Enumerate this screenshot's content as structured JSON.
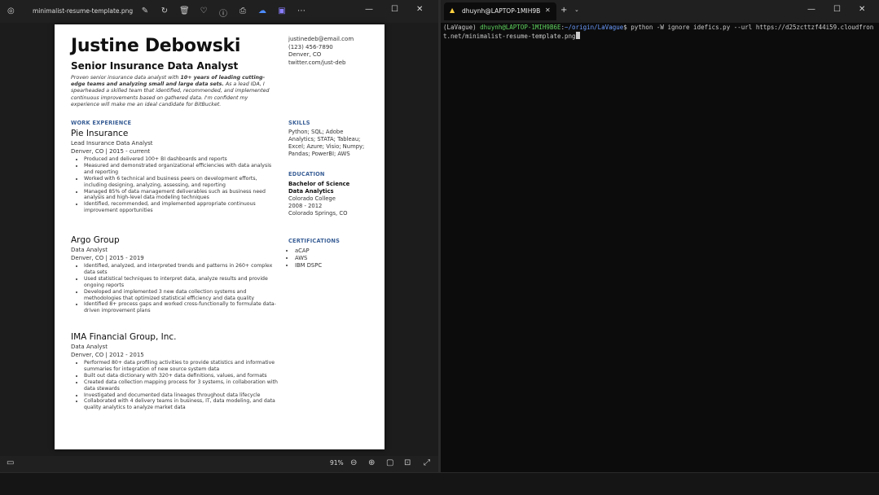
{
  "viewer": {
    "title": "minimalist-resume-template.png",
    "zoom": "91%",
    "icons": {
      "app": "photos-icon",
      "tools": [
        "edit-icon",
        "rotate-icon",
        "delete-icon",
        "favorite-icon",
        "info-icon",
        "print-icon",
        "cloud-icon",
        "share-icon",
        "more-icon"
      ]
    }
  },
  "resume": {
    "name": "Justine Debowski",
    "role": "Senior Insurance Data Analyst",
    "contact": [
      "justinedeb@email.com",
      "(123) 456-7890",
      "Denver, CO",
      "twitter.com/just-deb"
    ],
    "summary_a": "Proven senior insurance data analyst with ",
    "summary_b": "10+ years of leading cutting-edge teams and analyzing small and large data sets.",
    "summary_c": " As a lead IDA, I spearheaded a skilled team that identified, recommended, and implemented continuous improvements based on gathered data. I'm confident my experience will make me an ideal candidate for BitBucket.",
    "work_heading": "WORK EXPERIENCE",
    "jobs": [
      {
        "company": "Pie Insurance",
        "title": "Lead Insurance Data Analyst",
        "meta": "Denver, CO  |  2015 - current",
        "bullets": [
          "Produced and delivered 100+ BI dashboards and reports",
          "Measured and demonstrated organizational efficiencies with data analysis and reporting",
          "Worked with 6 technical and business peers on development efforts, including designing, analyzing, assessing, and reporting",
          "Managed 85% of data management deliverables such as business need analysis and high-level data modeling techniques",
          "Identified, recommended, and implemented appropriate continuous improvement opportunities"
        ]
      },
      {
        "company": "Argo Group",
        "title": "Data Analyst",
        "meta": "Denver, CO  |  2015 - 2019",
        "bullets": [
          "Identified, analyzed, and interpreted trends and patterns in 260+ complex data sets",
          "Used statistical techniques to interpret data, analyze results and provide ongoing reports",
          "Developed and implemented 3 new data collection systems and methodologies that optimized statistical efficiency and data quality",
          "Identified 8+ process gaps and worked cross-functionally to formulate data-driven improvement plans"
        ]
      },
      {
        "company": "IMA Financial Group, Inc.",
        "title": "Data Analyst",
        "meta": "Denver, CO  |  2012 - 2015",
        "bullets": [
          "Performed 80+ data profiling activities to provide statistics and informative summaries for integration of new source system data",
          "Built out data dictionary with 320+ data definitions, values, and formats",
          "Created data collection mapping process for 3 systems, in collaboration with data stewards",
          "Investigated and documented data lineages throughout data lifecycle",
          "Collaborated with 4 delivery teams in business, IT, data modeling, and data quality analytics to analyze market data"
        ]
      }
    ],
    "skills_heading": "SKILLS",
    "skills": "Python; SQL; Adobe Analytics; STATA; Tableau; Excel; Azure; Visio; Numpy; Pandas; PowerBI; AWS",
    "education_heading": "EDUCATION",
    "degree": "Bachelor of Science",
    "major": "Data Analytics",
    "school": "Colorado College",
    "years": "2008 - 2012",
    "location": "Colorado Springs, CO",
    "cert_heading": "CERTIFICATIONS",
    "certs": [
      "aCAP",
      "AWS",
      "IBM DSPC"
    ]
  },
  "terminal": {
    "tab_title": "dhuynh@LAPTOP-1MIH9B6E:",
    "prompt_env": "(LaVague) ",
    "prompt_user": "dhuynh@LAPTOP-1MIH9B6E",
    "prompt_sep": ":",
    "prompt_path": "~/origin/LaVague",
    "prompt_end": "$ ",
    "command": "python -W ignore idefics.py --url https://d25zcttzf44i59.cloudfront.net/minimalist-resume-template.png"
  }
}
